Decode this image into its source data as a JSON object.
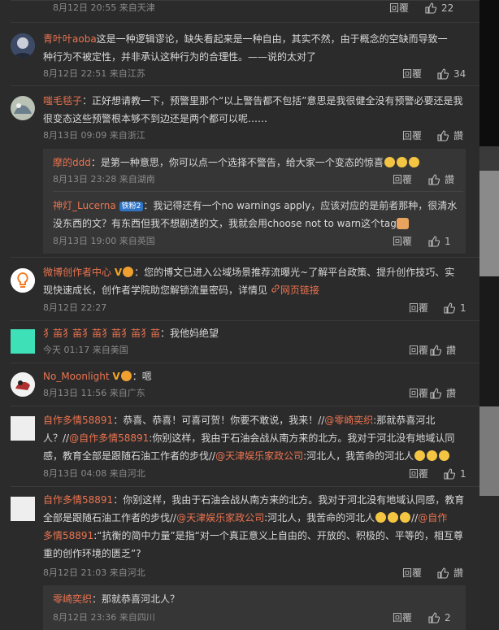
{
  "c0": {
    "time": "8月12日 20:55",
    "loc": "来自天津",
    "reply": "回覆",
    "likes": "22"
  },
  "c1": {
    "user": "青叶叶aoba",
    "sep": "：",
    "l1": "这是一种逻辑谬论，缺失看起来是一种自由，其实不然，由于概念的空缺而导致一",
    "l2": "种行为不被定性，并非承认这种行为的合理性。——说的太对了",
    "time": "8月12日 22:51",
    "loc": "来自江苏",
    "reply": "回覆",
    "likes": "34"
  },
  "c2": {
    "user": "嗤毛毯子",
    "sep": "：",
    "l1": "正好想请教一下，预警里那个“以上警告都不包括”意思是我很健全没有预警必要还是我",
    "l2": "很变态这些预警根本够不到边还是两个都可以呢……",
    "time": "8月13日 09:09",
    "loc": "来自浙江",
    "reply": "回覆",
    "likes": "讚"
  },
  "r1": {
    "user": "摩的ddd",
    "text": "：是第一种意思，你可以点一个选择不警告，给大家一个变态的惊喜",
    "time": "8月13日 23:28",
    "loc": "来自湖南",
    "reply": "回覆",
    "likes": "讚"
  },
  "r2": {
    "user": "神灯_Lucerna",
    "level": "铁粉2",
    "l1": "：我记得还有一个no warnings apply，应该对应的是前者那种，很清水",
    "l2": "没东西的文？有东西但我不想剧透的文，我就会用choose not to warn这个tag",
    "time": "8月13日 19:00",
    "loc": "来自英国",
    "reply": "回覆",
    "likes": "1"
  },
  "c3": {
    "user": "微博创作者中心",
    "l1": "：您的博文已进入公域场景推荐流曝光~了解平台政策、提升创作技巧、实",
    "l2a": "现快速成长，创作者学院助您解锁流量密码，详情见",
    "l2b": "网页链接",
    "time": "8月12日 22:27",
    "reply": "回覆",
    "likes": "1"
  },
  "c4": {
    "user": "犭苖犭苖犭苖犭苖犭苖犭苖",
    "text": "：我他妈绝望",
    "time": "今天 01:17",
    "loc": "来自美国",
    "reply": "回覆",
    "likes": "讚"
  },
  "c5": {
    "user": "No_Moonlight",
    "text": "：嗯",
    "time": "8月13日 11:56",
    "loc": "来自广东",
    "reply": "回覆",
    "likes": "讚"
  },
  "c6": {
    "user": "自作多情58891",
    "l1a": "：恭喜、恭喜！可喜可贺！你要不敢说，我来！//",
    "l1b": "@零崎奕织",
    "l1c": ":那就恭喜河北",
    "l2a": "人？//",
    "l2b": "@自作多情58891",
    "l2c": ":你别这样，我由于石油会战从南方来的北方。我对于河北没有地域认同",
    "l3a": "感，教育全部是跟随石油工作者的步伐//",
    "l3b": "@天津娱乐家政公司",
    "l3c": ":河北人，我苦命的河北人",
    "time": "8月13日 04:08",
    "loc": "来自河北",
    "reply": "回覆",
    "likes": "1"
  },
  "c7": {
    "user": "自作多情58891",
    "l1": "：你别这样，我由于石油会战从南方来的北方。我对于河北没有地域认同感，教育",
    "l2a": "全部是跟随石油工作者的步伐//",
    "l2b": "@天津娱乐家政公司",
    "l2c": ":河北人，我苦命的河北人",
    "l2d": "//",
    "l2e": "@自作",
    "l3a": "多情58891",
    "l3b": ":“抗衡的简中力量”是指“对一个真正意义上自由的、开放的、积极的、平等的，相互尊",
    "l4": "重的创作环境的匮乏”?",
    "time": "8月12日 21:03",
    "loc": "来自河北",
    "reply": "回覆",
    "likes": "讚"
  },
  "r3": {
    "user": "零崎奕织",
    "text": "：那就恭喜河北人？",
    "time": "8月12日 23:36",
    "loc": "来自四川",
    "reply": "回覆",
    "likes": "2"
  }
}
